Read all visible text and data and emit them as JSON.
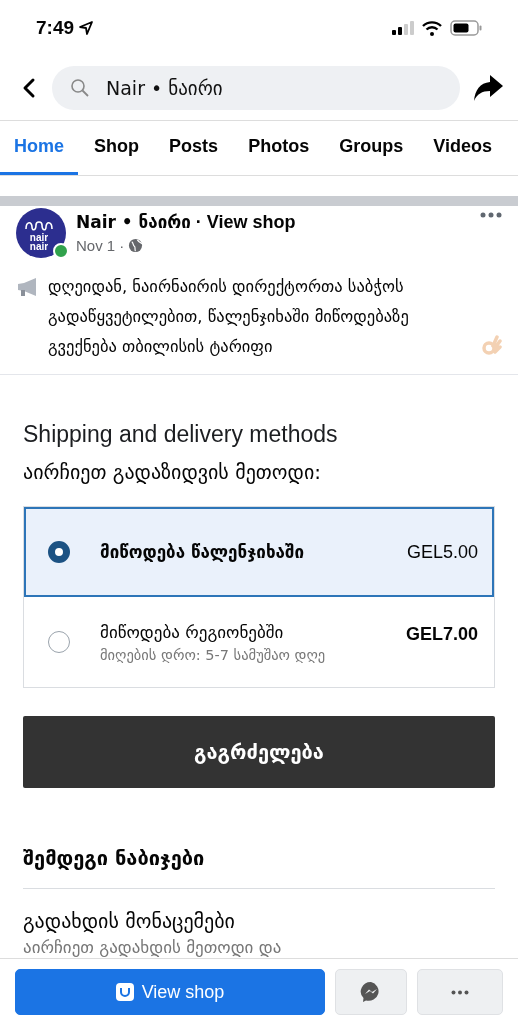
{
  "status_bar": {
    "time": "7:49"
  },
  "header": {
    "search_value": "Nair • ნაირი"
  },
  "tabs": [
    {
      "label": "Home",
      "selected": true
    },
    {
      "label": "Shop",
      "selected": false
    },
    {
      "label": "Posts",
      "selected": false
    },
    {
      "label": "Photos",
      "selected": false
    },
    {
      "label": "Groups",
      "selected": false
    },
    {
      "label": "Videos",
      "selected": false
    }
  ],
  "post": {
    "avatar_text": "nair nair",
    "online": true,
    "author": "Nair • ნაირი",
    "separator": "·",
    "link": "View shop",
    "date": "Nov 1 ·",
    "text": "დღეიდან, ნაირნაირის დირექტორთა საბჭოს გადაწყვეტილებით, წალენჯიხაში მიწოდებაზე გვექნება თბილისის ტარიფი"
  },
  "shipping": {
    "title": "Shipping and delivery methods",
    "subtitle": "აირჩიეთ გადაზიდვის მეთოდი:",
    "options": [
      {
        "name": "მიწოდება წალენჯიხაში",
        "price": "GEL5.00",
        "selected": true
      },
      {
        "name": "მიწოდება რეგიონებში",
        "price": "GEL7.00",
        "note": "მიღების დრო: 5-7 სამუშაო დღე",
        "selected": false
      }
    ],
    "continue_button": "გაგრძელება"
  },
  "next_steps": {
    "title": "შემდეგი ნაბიჯები",
    "item_title": "გადახდის მონაცემები",
    "item_subtitle": "აირჩიეთ გადახდის მეთოდი და"
  },
  "bottom_bar": {
    "view_shop": "View shop"
  }
}
